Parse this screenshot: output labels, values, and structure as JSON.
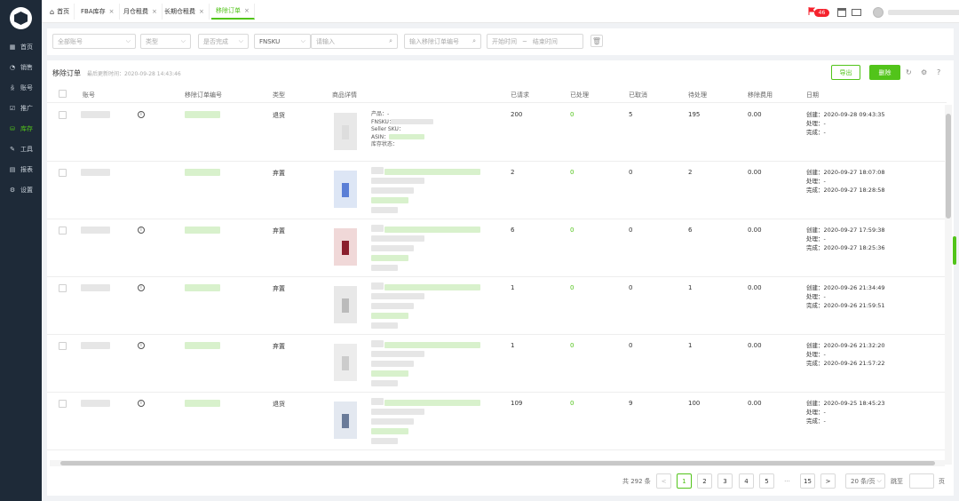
{
  "sidebar": {
    "items": [
      {
        "label": "首页",
        "icon": "grid-icon",
        "glyph": "▦"
      },
      {
        "label": "销售",
        "icon": "chart-icon",
        "glyph": "◔"
      },
      {
        "label": "账号",
        "icon": "user-icon",
        "glyph": "ꆜ"
      },
      {
        "label": "推广",
        "icon": "promo-icon",
        "glyph": "☑"
      },
      {
        "label": "库存",
        "icon": "inventory-icon",
        "glyph": "⛁",
        "active": true
      },
      {
        "label": "工具",
        "icon": "wrench-icon",
        "glyph": "✎"
      },
      {
        "label": "报表",
        "icon": "report-icon",
        "glyph": "▤"
      },
      {
        "label": "设置",
        "icon": "gear-icon",
        "glyph": "⚙"
      }
    ]
  },
  "tabs": [
    {
      "label": "首页",
      "home": true
    },
    {
      "label": "FBA库存"
    },
    {
      "label": "月仓租费"
    },
    {
      "label": "长期仓租费"
    },
    {
      "label": "移除订单",
      "active": true
    }
  ],
  "topbar": {
    "badge": "46"
  },
  "filters": {
    "account": "全部账号",
    "type": "类型",
    "completed": "是否完成",
    "fnsku": "FNSKU",
    "keyword_placeholder": "请输入",
    "order_placeholder": "输入移除订单编号",
    "start_time": "开始时间",
    "tilde": "~",
    "end_time": "结束时间"
  },
  "panel": {
    "title": "移除订单",
    "updated": "最后更新时间：2020-09-28 14:43:46",
    "export": "导出",
    "delete": "删除"
  },
  "table": {
    "headers": [
      "账号",
      "移除订单编号",
      "类型",
      "商品详情",
      "已请求",
      "已处理",
      "已取消",
      "待处理",
      "移除费用",
      "日期"
    ],
    "detail_labels": [
      "产品：-",
      "FNSKU：",
      "Seller SKU：",
      "ASIN：",
      "库存状态："
    ],
    "rows": [
      {
        "type": "退货",
        "info": true,
        "requested": "200",
        "processed": "0",
        "cancelled": "5",
        "pending": "195",
        "fee": "0.00",
        "created": "创建：2020-09-28 09:43:35",
        "handled": "处理：-",
        "done": "完成：-",
        "labels": true
      },
      {
        "type": "弃置",
        "info": false,
        "requested": "2",
        "processed": "0",
        "cancelled": "0",
        "pending": "2",
        "fee": "0.00",
        "created": "创建：2020-09-27 18:07:08",
        "handled": "处理：-",
        "done": "完成：2020-09-27 18:28:58",
        "labels": false
      },
      {
        "type": "弃置",
        "info": true,
        "requested": "6",
        "processed": "0",
        "cancelled": "0",
        "pending": "6",
        "fee": "0.00",
        "created": "创建：2020-09-27 17:59:38",
        "handled": "处理：-",
        "done": "完成：2020-09-27 18:25:36",
        "labels": false
      },
      {
        "type": "弃置",
        "info": true,
        "requested": "1",
        "processed": "0",
        "cancelled": "0",
        "pending": "1",
        "fee": "0.00",
        "created": "创建：2020-09-26 21:34:49",
        "handled": "处理：-",
        "done": "完成：2020-09-26 21:59:51",
        "labels": false
      },
      {
        "type": "弃置",
        "info": true,
        "requested": "1",
        "processed": "0",
        "cancelled": "0",
        "pending": "1",
        "fee": "0.00",
        "created": "创建：2020-09-26 21:32:20",
        "handled": "处理：-",
        "done": "完成：2020-09-26 21:57:22",
        "labels": false
      },
      {
        "type": "退货",
        "info": true,
        "requested": "109",
        "processed": "0",
        "cancelled": "9",
        "pending": "100",
        "fee": "0.00",
        "created": "创建：2020-09-25 18:45:23",
        "handled": "处理：-",
        "done": "完成：-",
        "labels": false
      }
    ]
  },
  "pagination": {
    "total": "共 292 条",
    "pages": [
      "1",
      "2",
      "3",
      "4",
      "5",
      "···",
      "15"
    ],
    "prev": "<",
    "next": ">",
    "size": "20 条/页",
    "jump": "跳至",
    "page_unit": "页"
  },
  "colors": {
    "accent": "#52c41a",
    "sidebar": "#1e2a38",
    "badge": "#f5222d"
  }
}
